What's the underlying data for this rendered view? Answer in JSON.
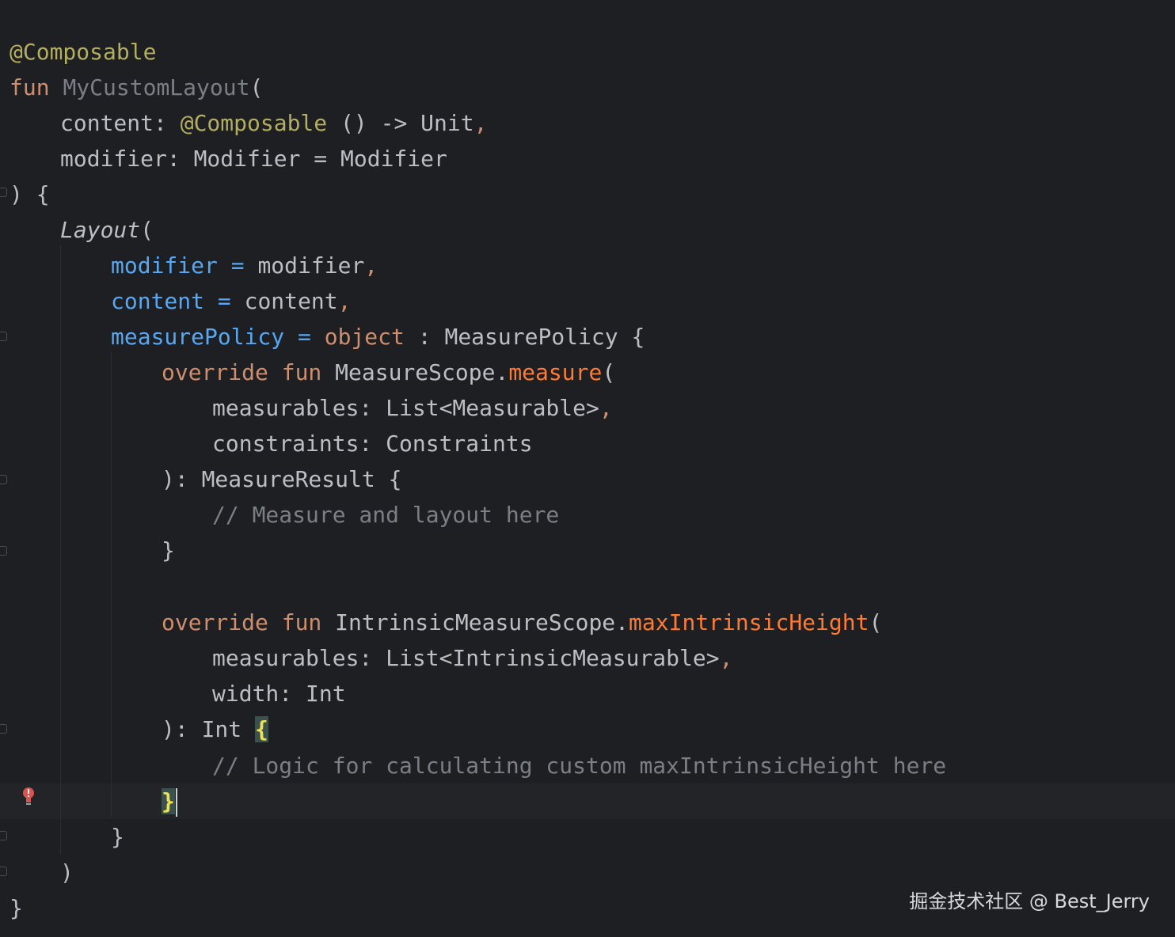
{
  "code": {
    "l1": {
      "annotation": "@Composable"
    },
    "l2": {
      "keyword": "fun",
      "name": "MyCustomLayout",
      "open": "("
    },
    "l3": {
      "label": "content: ",
      "annotation": "@Composable",
      "rest": " () -> Unit",
      "comma": ","
    },
    "l4": {
      "text": "modifier: Modifier = Modifier"
    },
    "l5": {
      "text": ") {"
    },
    "l6": {
      "call": "Layout",
      "open": "("
    },
    "l7": {
      "param": "modifier",
      "eq": " = ",
      "value": "modifier",
      "comma": ","
    },
    "l8": {
      "param": "content",
      "eq": " = ",
      "value": "content",
      "comma": ","
    },
    "l9": {
      "param": "measurePolicy",
      "eq": " = ",
      "keyword": "object",
      "rest": " : MeasurePolicy {"
    },
    "l10": {
      "override": "override",
      "fun": " fun ",
      "receiver": "MeasureScope.",
      "method": "measure",
      "open": "("
    },
    "l11": {
      "text": "measurables: List<Measurable>",
      "comma": ","
    },
    "l12": {
      "text": "constraints: Constraints"
    },
    "l13": {
      "text": "): MeasureResult {"
    },
    "l14": {
      "comment": "// Measure and layout here"
    },
    "l15": {
      "text": "}"
    },
    "l17": {
      "override": "override",
      "fun": " fun ",
      "receiver": "IntrinsicMeasureScope.",
      "method": "maxIntrinsicHeight",
      "open": "("
    },
    "l18": {
      "text": "measurables: List<IntrinsicMeasurable>",
      "comma": ","
    },
    "l19": {
      "text": "width: Int"
    },
    "l20": {
      "text": "): Int ",
      "brace": "{"
    },
    "l21": {
      "comment": "// Logic for calculating custom maxIntrinsicHeight here"
    },
    "l22": {
      "brace": "}"
    },
    "l23": {
      "text": "}"
    },
    "l24": {
      "text": ")"
    },
    "l25": {
      "text": "}"
    }
  },
  "watermark": "掘金技术社区 @ Best_Jerry",
  "colors": {
    "background": "#1e1f22",
    "annotation": "#b3ae60",
    "keyword": "#cf8e6d",
    "parameter": "#56a8f5",
    "function_call": "#ff7b33",
    "comment": "#7a7e85",
    "text": "#bcbec4"
  },
  "icons": {
    "gutter_marker": "lightbulb-error-icon"
  }
}
